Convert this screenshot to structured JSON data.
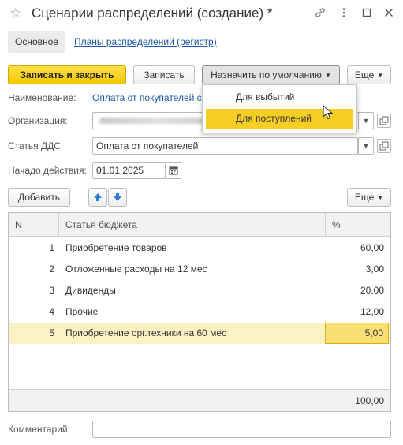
{
  "window": {
    "title": "Сценарии распределений (создание) *"
  },
  "nav": {
    "main_tab": "Основное",
    "register_link": "Планы распределений (регистр)"
  },
  "toolbar": {
    "save_close": "Записать и закрыть",
    "save": "Записать",
    "set_default": "Назначить по умолчанию",
    "more": "Еще"
  },
  "dropdown": {
    "items": [
      "Для выбытий",
      "Для поступлений"
    ],
    "highlighted": "Для поступлений"
  },
  "form": {
    "name_label": "Наименование:",
    "name_value": "Оплата от покупателей с",
    "org_label": "Организация:",
    "dds_label": "Статья ДДС:",
    "dds_value": "Оплата от покупателей",
    "start_label": "Начадо действия:",
    "start_value": "01.01.2025",
    "comment_label": "Комментарий:",
    "comment_value": ""
  },
  "table_toolbar": {
    "add": "Добавить",
    "more": "Еще"
  },
  "table": {
    "columns": [
      "N",
      "Статья бюджета",
      "%"
    ],
    "rows": [
      {
        "n": "1",
        "name": "Приобретение товаров",
        "pct": "60,00"
      },
      {
        "n": "2",
        "name": "Отложенные расходы на 12 мес",
        "pct": "3,00"
      },
      {
        "n": "3",
        "name": "Дивиденды",
        "pct": "20,00"
      },
      {
        "n": "4",
        "name": "Прочие",
        "pct": "12,00"
      },
      {
        "n": "5",
        "name": "Приобретение орг.техники на 60 мес",
        "pct": "5,00"
      }
    ],
    "selected_row": "5",
    "total": "100,00"
  },
  "colors": {
    "accent_yellow": "#f7ce24",
    "link_blue": "#1c5aa6",
    "selected_row": "#fbf1c4"
  },
  "icons": [
    "star-icon",
    "link-icon",
    "kebab-icon",
    "maximize-icon",
    "close-icon",
    "dropdown-arrow-icon",
    "open-icon",
    "calendar-icon",
    "arrow-up-icon",
    "arrow-down-icon",
    "mouse-cursor-icon"
  ]
}
